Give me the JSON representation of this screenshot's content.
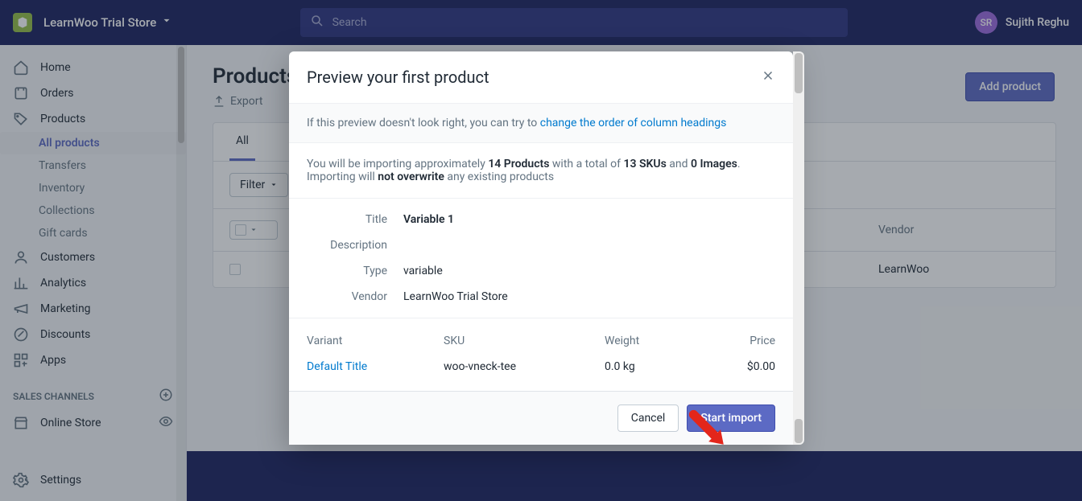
{
  "header": {
    "store_name": "LearnWoo Trial Store",
    "search_placeholder": "Search",
    "user_initials": "SR",
    "user_name": "Sujith Reghu"
  },
  "sidebar": {
    "items": [
      {
        "label": "Home"
      },
      {
        "label": "Orders"
      },
      {
        "label": "Products"
      },
      {
        "label": "Customers"
      },
      {
        "label": "Analytics"
      },
      {
        "label": "Marketing"
      },
      {
        "label": "Discounts"
      },
      {
        "label": "Apps"
      }
    ],
    "products_sub": [
      {
        "label": "All products"
      },
      {
        "label": "Transfers"
      },
      {
        "label": "Inventory"
      },
      {
        "label": "Collections"
      },
      {
        "label": "Gift cards"
      }
    ],
    "section_header": "SALES CHANNELS",
    "channels": [
      {
        "label": "Online Store"
      }
    ],
    "settings": "Settings"
  },
  "page": {
    "title": "Products",
    "export": "Export",
    "add_product": "Add product",
    "tab_all": "All",
    "filter_label": "Filter",
    "col_vendor": "Vendor",
    "row_vendor": "LearnWoo"
  },
  "modal": {
    "title": "Preview your first product",
    "band_prefix": "If this preview doesn't look right, you can try to ",
    "band_link": "change the order of column headings",
    "body_pre": "You will be importing approximately ",
    "body_products": "14 Products",
    "body_mid1": " with a total of ",
    "body_skus": "13 SKUs",
    "body_mid2": " and ",
    "body_images": "0 Images",
    "body_tail": ". Importing will ",
    "body_not_overwrite": "not overwrite",
    "body_tail2": " any existing products",
    "kv": {
      "title_k": "Title",
      "title_v": "Variable 1",
      "desc_k": "Description",
      "desc_v": "",
      "type_k": "Type",
      "type_v": "variable",
      "vendor_k": "Vendor",
      "vendor_v": "LearnWoo Trial Store"
    },
    "variants": {
      "h_variant": "Variant",
      "h_sku": "SKU",
      "h_weight": "Weight",
      "h_price": "Price",
      "r_variant": "Default Title",
      "r_sku": "woo-vneck-tee",
      "r_weight": "0.0 kg",
      "r_price": "$0.00"
    },
    "cancel": "Cancel",
    "start": "Start import"
  }
}
